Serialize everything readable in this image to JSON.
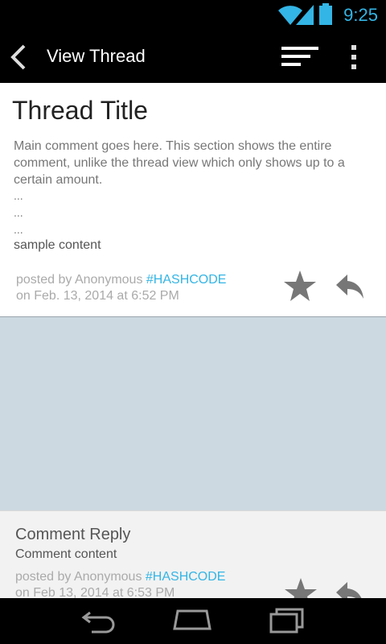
{
  "status_bar": {
    "time": "9:25"
  },
  "action_bar": {
    "title": "View Thread"
  },
  "thread": {
    "title": "Thread Title",
    "comment": "Main comment goes here. This section shows the entire comment, unlike the thread view which only shows up to a certain amount.",
    "dots": [
      "...",
      "...",
      "..."
    ],
    "sample": "sample content",
    "posted_by": "posted by Anonymous",
    "hashcode": "#HASHCODE",
    "date": "on Feb. 13, 2014 at 6:52 PM"
  },
  "reply": {
    "title": "Comment Reply",
    "content": "Comment content",
    "posted_by": "posted by Anonymous",
    "hashcode": "#HASHCODE",
    "date": "on Feb 13, 2014 at 6:53 PM"
  },
  "colors": {
    "accent": "#33b5e5",
    "icon_gray": "#777777",
    "background": "#cdd9e0"
  }
}
